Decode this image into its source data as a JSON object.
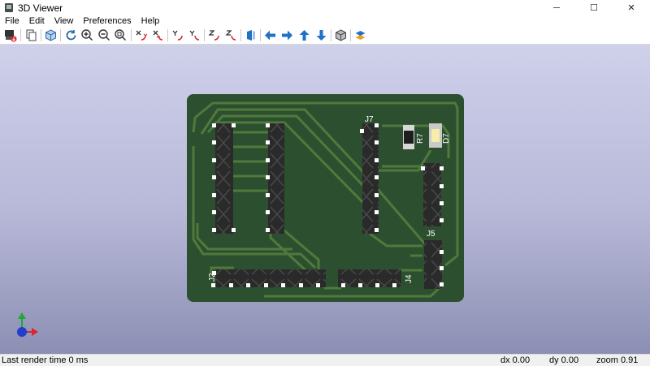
{
  "window": {
    "title": "3D Viewer",
    "controls": {
      "minimize": "─",
      "maximize": "☐",
      "close": "✕"
    }
  },
  "menu": [
    "File",
    "Edit",
    "View",
    "Preferences",
    "Help"
  ],
  "toolbar_icons": [
    "export-image-icon",
    "copy-icon",
    "cube-icon",
    "reload-icon",
    "zoom-in-icon",
    "zoom-out-icon",
    "zoom-fit-icon",
    "rotate-x-cw-icon",
    "rotate-x-ccw-icon",
    "rotate-y-cw-icon",
    "rotate-y-ccw-icon",
    "rotate-z-cw-icon",
    "rotate-z-ccw-icon",
    "flip-board-icon",
    "pan-left-icon",
    "pan-right-icon",
    "pan-up-icon",
    "pan-down-icon",
    "ortho-toggle-icon",
    "layers-icon"
  ],
  "pcb": {
    "labels": {
      "j7": "J7",
      "r7": "R7",
      "d7": "D7",
      "j5": "J5",
      "j2": "J2",
      "j4": "J4"
    }
  },
  "status": {
    "render_time": "Last render time 0 ms",
    "dx": "dx 0.00",
    "dy": "dy 0.00",
    "zoom": "zoom 0.91"
  },
  "colors": {
    "board": "#2c4f2f",
    "trace": "#4f7a3c",
    "viewport_top": "#cfd0ea",
    "viewport_bottom": "#8c8fb3",
    "arrow_blue": "#1f72c4"
  }
}
